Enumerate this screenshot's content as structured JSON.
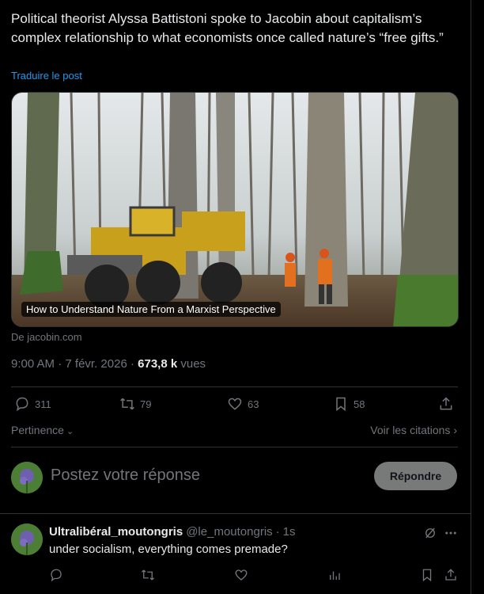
{
  "post": {
    "text": "Political theorist Alyssa Battistoni spoke to Jacobin about capitalism’s complex relationship to what economists once called nature’s “free gifts.”",
    "translate_label": "Traduire le post"
  },
  "card": {
    "title": "How to Understand Nature From a Marxist Perspective",
    "source": "De jacobin.com"
  },
  "meta": {
    "time": "9:00 AM",
    "date": "7 févr. 2026",
    "views_count": "673,8 k",
    "views_label": "vues"
  },
  "actions": {
    "replies": "311",
    "reposts": "79",
    "likes": "63",
    "bookmarks": "58"
  },
  "sort": {
    "label": "Pertinence",
    "quotes_label": "Voir les citations"
  },
  "compose": {
    "placeholder": "Postez votre réponse",
    "button_label": "Répondre"
  },
  "reply": {
    "name": "Ultralibéral_moutongris",
    "handle": "@le_moutongris",
    "time": "1s",
    "text": "under socialism, everything comes premade?"
  },
  "colors": {
    "accent": "#1d9bf0",
    "muted": "#71767b",
    "text": "#e7e9ea",
    "border": "#2f3336"
  }
}
